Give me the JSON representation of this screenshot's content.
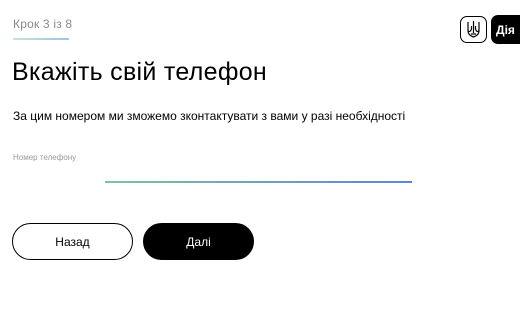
{
  "header": {
    "step_text": "Крок 3 із 8",
    "logo_label": "Дія",
    "emblem_icon": "trident-icon"
  },
  "main": {
    "title": "Вкажіть свій телефон",
    "subtitle": "За цим номером ми зможемо зконтактувати з вами у разі необхідності"
  },
  "form": {
    "phone_label": "Номер телефону",
    "phone_value": ""
  },
  "buttons": {
    "back_label": "Назад",
    "next_label": "Далі"
  },
  "colors": {
    "primary": "#000000",
    "background": "#ffffff",
    "muted_text": "#8a8a8a",
    "underline_start": "#7fc2a0",
    "underline_end": "#5a86d6"
  }
}
